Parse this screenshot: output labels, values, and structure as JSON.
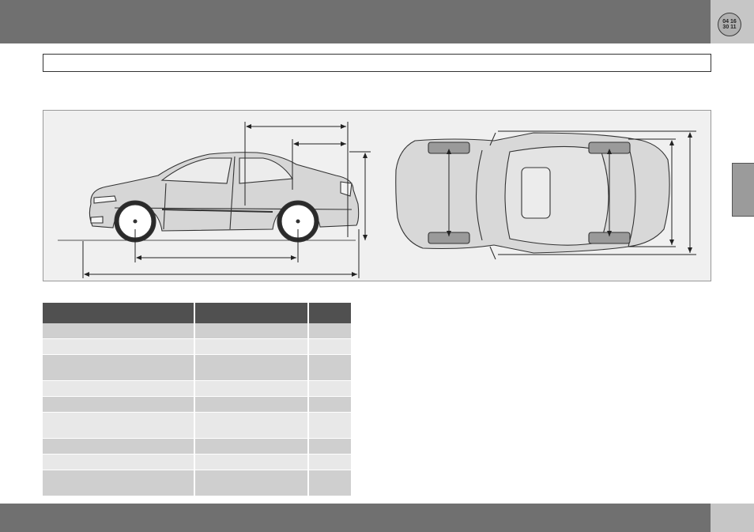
{
  "header": {
    "badge_line1": "04 16",
    "badge_line2": "30 11"
  },
  "title": "",
  "diagram": {
    "side_view": "sedan-side-view",
    "top_view": "sedan-top-view"
  },
  "table": {
    "header": [
      "",
      "",
      ""
    ],
    "rows": [
      {
        "tone": "dark",
        "height": 19
      },
      {
        "tone": "light",
        "height": 19
      },
      {
        "tone": "dark",
        "height": 32
      },
      {
        "tone": "light",
        "height": 19
      },
      {
        "tone": "dark",
        "height": 19
      },
      {
        "tone": "light",
        "height": 32
      },
      {
        "tone": "dark",
        "height": 19
      },
      {
        "tone": "light",
        "height": 19
      },
      {
        "tone": "dark",
        "height": 32
      }
    ]
  },
  "footer": {
    "page_number": ""
  }
}
